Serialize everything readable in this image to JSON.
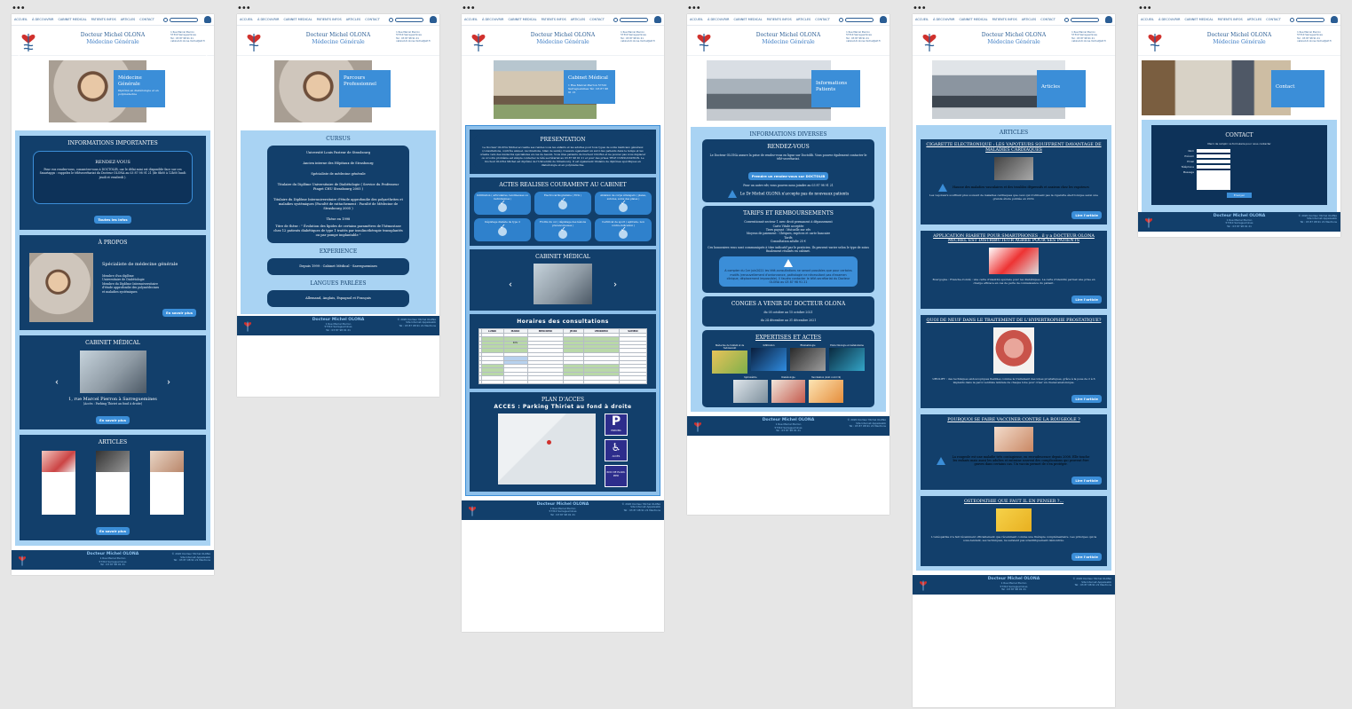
{
  "nav": {
    "items": [
      "ACCUEIL",
      "À DECOUVRIR",
      "CABINET MEDICAL",
      "PATIENTS INFOS",
      "ARTICLES",
      "CONTACT"
    ],
    "items_alt": [
      "ACCUEIL",
      "À DECOUVRIR",
      "CABINET MEDICAL",
      "PATIENTS INFOS",
      "ARTICLES",
      "CONTACT"
    ]
  },
  "header": {
    "doctor": "Docteur Michel OLONA",
    "specialty": "Médecine Générale",
    "address_line1": "1 Rue Marcel Pierron",
    "address_line2": "57310 Sarreguemines",
    "phone": "Tel : 03 87 98 91 21",
    "email": "cabinet.dr.olona.michel@sfr.fr"
  },
  "footer": {
    "name": "Docteur Michel OLONA",
    "address1": "1 Rue Marcel Pierron",
    "address2": "57310 Sarreguemines",
    "phone": "Tel : 03 87 98 91 21",
    "copy1": "© 2020 Docteur Michel OLONA",
    "copy2": "Site Internet Appelwebb",
    "copy3": "Tel : 03 87 98 91 21 Mentions"
  },
  "pages": {
    "home": {
      "hero_title": "Médecine Générale",
      "hero_sub": "Diplômé en diabétologie et en polymédecine",
      "info_title": "INFORMATIONS IMPORTANTES",
      "rdv_title": "RENDEZ-VOUS",
      "rdv_text": "Pour vos rendez-vous, connectez-vous à DOCTOLIB, car le délai mini est disponible face sur ces Smartapps : rappelez le télésecrétariat du Docteur OLONA au 03 87 98 91 21 (de 8h00 à 12h00 lundi jeudi et vendredi ).",
      "news_btn": "Toutes les infos",
      "about_title": "À PROPOS",
      "about_sub": "Spécialiste de médecine générale",
      "about_lines": [
        "Membre d'un diplôme",
        "Universitaire de Diabétologie",
        "Membre du Diplôme Interuniversitaire",
        "d'étude approfondie des polymédecines",
        "et maladies systémiques"
      ],
      "about_btn": "En savoir plus",
      "cabinet_title": "CABINET MÉDICAL",
      "cabinet_addr": "1, rue Marcel Pierron à Sarreguemines",
      "cabinet_parking": "(Accès : Parking Thiriet au fond à droite)",
      "cabinet_btn": "En savoir plus",
      "articles_title": "ARTICLES",
      "articles_btn": "En savoir plus"
    },
    "parcours": {
      "hero_title": "Parcours Professionnel",
      "cursus_title": "CURSUS",
      "cursus": [
        "Université Louis Pasteur de Strasbourg",
        "Ancien interne des Hôpitaux de Strasbourg",
        "Spécialiste de médecine générale",
        "Titulaire du Diplôme Universitaire de Diabétologie ( Service du Professeur Pinget CHU Strasbourg 2005 )",
        "Titulaire du Diplôme Interuniversitaire d'étude approfondie des polyarthrites et maladies systémiques (Faculté de rattachement : Faculté de Médecine de Strasbourg 2005 )",
        "Thèse en 1998",
        "Titre de thèse : \" Évolution des lipides de certains paramètres de l'hémostase chez 12 patients diabétiques de type 1 traités par insulinothérapie transplantés ou par pompe implantable \""
      ],
      "experience_title": "EXPERIENCE",
      "experience": "Depuis 1999 : Cabinet Médical - Sarreguemines",
      "languages_title": "LANGUES PARLÉES",
      "languages": "Allemand, Anglais, Espagnol et Français"
    },
    "cabinet": {
      "hero_title": "Cabinet Médical",
      "hero_sub": "1 Rue Marcel Pierron 57310 Sarreguemines Tél : 03 87 98 91 21",
      "presentation_title": "PRESENTATION",
      "presentation_text": "Le Docteur OLONA Michel accueille ses rendez-vous les enfants et les adultes pour tous types de soins médicaux généraux (consultations, contrôle annuel, vaccinations, bilan de santé). Il assure également un suivi des patients dans le temps et les oriente vers des médecins spécialistes en cas de besoin. Vous êtes patients du Docteur OLONA et ne pouvez pas vous déplacer ou si votre problème est simple contactez le télé secrétariat au 03 87 98 91 21 et pour des prises TELE CONSULTATION. Le Docteur OLONA Michel est diplômé de l'Université de Strasbourg. Il est également titulaire de diplômes spécifiques en diabétologie et en polymédecine.",
      "actes_title": "ACTES REALISES COURAMENT AU CABINET",
      "actes": [
        "Infiltration ( articulaires, tendineuses ou rachidiennes )",
        "Électrocardiogramme ( ECG )",
        "Ablation de corps étrangers ( plaies, sutures, soins des plaies )",
        "Dépistage diabète de type 2",
        "Frottis du col ( dépistage des lésions précancéreuses )",
        "Certificat de sport ( aptitude, non contre-indication )"
      ],
      "gallery_title": "CABINET MÉDICAL",
      "schedule_title": "Horaires des consultations",
      "schedule_days": [
        "LUNDI",
        "MARDI",
        "MERCREDI",
        "JEUDI",
        "VENDREDI",
        "SAMEDI"
      ],
      "schedule_slot": "RDV",
      "access_title": "PLAN D'ACCES",
      "access_sub": "ACCES : Parking Thiriet au fond à droite",
      "badges": [
        "PARKING",
        "ACCÈS",
        "RDC DE PLAIN-PIED"
      ]
    },
    "infos": {
      "hero_title": "Informations Patients",
      "section_title": "INFORMATIONS DIVERSES",
      "rdv_title": "RENDEZ-VOUS",
      "rdv_text": "Le Docteur OLONA assure la prise de rendez-vous en ligne sur Doctolib. Vous pouvez également contacter le télé-secrétariat.",
      "rdv_btn": "Prendre un rendez-vous sur DOCTOLIB",
      "rdv_alt": "Pour un autre rdv, vous pouvez nous joindre au 03 87 98 91 21",
      "rdv_warn": "Le Dr Michel OLONA n'accepte pas de nouveaux patients",
      "tarifs_title": "TARIFS ET REMBOURSEMENTS",
      "tarifs_lines": [
        "Conventionné secteur 1 avec droit permanent à dépassement",
        "Carte Vitale acceptée",
        "Tiers payant : Mutuelle sur rdv",
        "Moyens de paiement : Chèques, espèces et carte bancaire",
        "Tarifs",
        "Consultation adulte 25 €"
      ],
      "tarifs_text": "Ces honoraires vous sont communiqués à titre indicatif par le praticien. Ils peuvent varier selon le type de soins finalement réalisés en cabinet.",
      "notice_text": "A compter du 1er juin2021 les télé-consultations ne seront possibles que pour certains motifs (renouvellement d'ordonnance, pathologie ne nécessitant pas d'examen clinique, déplacement impossible). Il faudra contacter le télé-secrétariat du Docteur OLONA au 03 87 98 91 21",
      "conges_title": "CONGES A VENIR DU DOCTEUR OLONA",
      "conges_lines": [
        "du 05 octobre au 15 octobre 2021",
        "du 24 décembre au 31 décembre 2021"
      ],
      "expertise_title": "EXPERTISES ET ACTES",
      "expertises": [
        "Médecine de l'enfant et de l'adolescent",
        "Infiltration",
        "Rhumatologie",
        "Endocrinologie et métabolisme",
        "Spirométrie",
        "Diabétologie",
        "Vaccination (dont covid 19)"
      ]
    },
    "articles": {
      "hero_title": "Articles",
      "section_title": "ARTICLES",
      "items": [
        {
          "title": "CIGARETTE ELECTRONIQUE : LES VAPOTEURS SOUFFRENT DAVANTAGE DE MALADIES CARDIAQUES",
          "warn": "Hausse des maladies vasculaires et des troubles dépressifs et anxieux chez les vapoteurs",
          "text": "Les vapoteurs souffrent plus souvent de maladies cardiaques que ceux qui n'utilisent pas la cigarette électronique selon une grande étude publiée en 2019.",
          "btn": "Lire l'article"
        },
        {
          "title": "APPLICATION RIABETE POUR SMARTPHONES , il y a DOCTEUR OLONA MICHEL EST DISTRIBUTEUR AGREE POUR SES PATIENTS",
          "warn": "",
          "text": "Bourgogne : Franche-Comté : une carte d'identité spéciale pour les diabétiques. La carte d'identité permet une prise en charge efficace en cas de perte de connaissance du patient.",
          "btn": "Lire l'article"
        },
        {
          "title": "QUOI DE NEUF DANS LE TRAITEMENT DE L'HYPERTROPHIE PROSTATIQUE?",
          "warn": "",
          "text": "UROLIFT : des techniques endoscopiques flexibles comme le traitement des lobes prostatiques, grâce à la pose de 2 à 6 implants dans la paroi ventrale latérale de chaque lobe pour créer un chenal anatomique.",
          "btn": "Lire l'article"
        },
        {
          "title": "POURQUOI SE FAIRE VACCINER CONTRE LA ROUGEOLE ?",
          "warn": "La rougeole est une maladie très contagieuse, en recrudescence depuis 2008. Elle touche les enfants mais aussi les adultes et entraine souvent des complications qui peuvent être graves dans certains cas. Un vaccin permet de s'en protéger.",
          "text": "",
          "btn": "Lire l'article"
        },
        {
          "title": "OSTEOPATHIE QUE FAUT IL EN PENSER ?...",
          "warn": "",
          "text": "L'ostéopathie n'a fait récemment officiellement que récemment comme une thérapie complémentaire. Les principes qui la sous-tendent, ses techniques, ne seraient pas scientifiquement démontrés.",
          "btn": "Lire l'article"
        }
      ]
    },
    "contact": {
      "hero_title": "Contact",
      "section_title": "CONTACT",
      "form_hint": "Merci de remplir ce formulaire pour nous contacter",
      "fields": [
        "Nom",
        "Prénom",
        "Email",
        "Téléphone",
        "Message"
      ],
      "submit": "Envoyer"
    }
  },
  "colors": {
    "navy": "#123f6b",
    "accent": "#3b8ed8",
    "light": "#a9d3f3"
  }
}
